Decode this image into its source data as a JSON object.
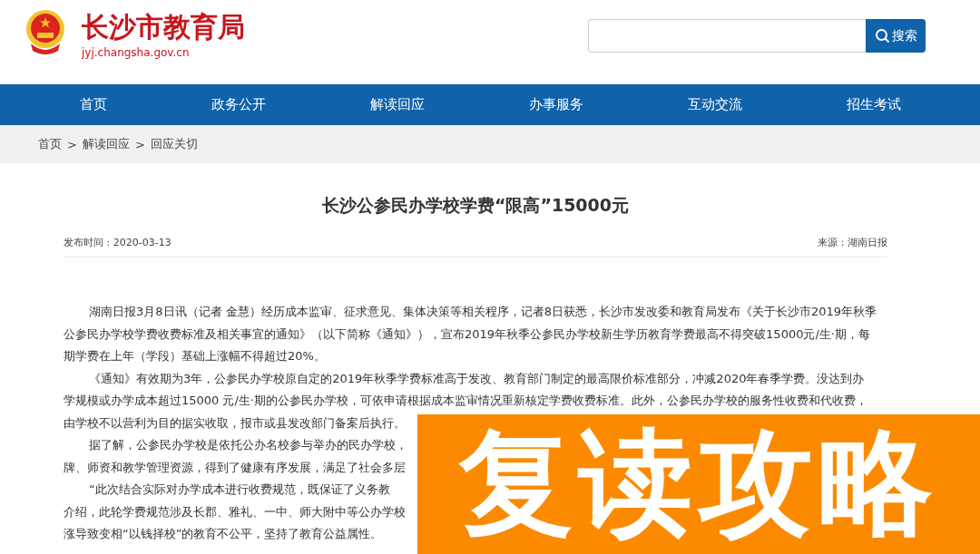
{
  "site": {
    "name": "长沙市教育局",
    "domain": "jyj.changsha.gov.cn"
  },
  "search": {
    "button": "搜索"
  },
  "nav": [
    {
      "label": "首页"
    },
    {
      "label": "政务公开"
    },
    {
      "label": "解读回应"
    },
    {
      "label": "办事服务"
    },
    {
      "label": "互动交流"
    },
    {
      "label": "招生考试"
    }
  ],
  "breadcrumb": {
    "items": [
      "首页",
      "解读回应",
      "回应关切"
    ],
    "separator": ">"
  },
  "article": {
    "title": "长沙公参民办学校学费“限高”15000元",
    "published": "发布时间 : 2020-03-13",
    "source": "来源：湖南日报",
    "paragraphs": [
      {
        "lines": [
          "湖南日报3月8日讯（记者 金慧）经历成本监审、征求意见、集体决策等相关程序，记者8日获悉，长沙市发改委和教育局发布《关于长沙市2019年秋季",
          "公参民办学校学费收费标准及相关事宜的通知》（以下简称《通知》），宣布2019年秋季公参民办学校新生学历教育学费最高不得突破15000元/生·期，每",
          "期学费在上年（学段）基础上涨幅不得超过20%。"
        ]
      },
      {
        "lines": [
          "《通知》有效期为3年，公参民办学校原自定的2019年秋季学费标准高于发改、教育部门制定的最高限价标准部分，冲减2020年春季学费。没达到办",
          "学规模或办学成本超过15000 元/生·期的公参民办学校，可依申请根据成本监审情况重新核定学费收费标准。此外，公参民办学校的服务性收费和代收费，",
          "由学校不以营利为目的据实收取，报市或县发改部门备案后执行。"
        ]
      },
      {
        "lines": [
          "据了解，公参民办学校是依托公办名校参与举办的民办学校，",
          "牌、师资和教学管理资源，得到了健康有序发展，满足了社会多层"
        ]
      },
      {
        "lines": [
          "“此次结合实际对办学成本进行收费规范，既保证了义务教",
          "介绍，此轮学费规范涉及长郡、雅礼、一中、师大附中等公办学校",
          "涨导致变相“以钱择校”的教育不公平，坚持了教育公益属性。"
        ]
      }
    ]
  },
  "overlay_banner": {
    "text": "复读攻略"
  }
}
